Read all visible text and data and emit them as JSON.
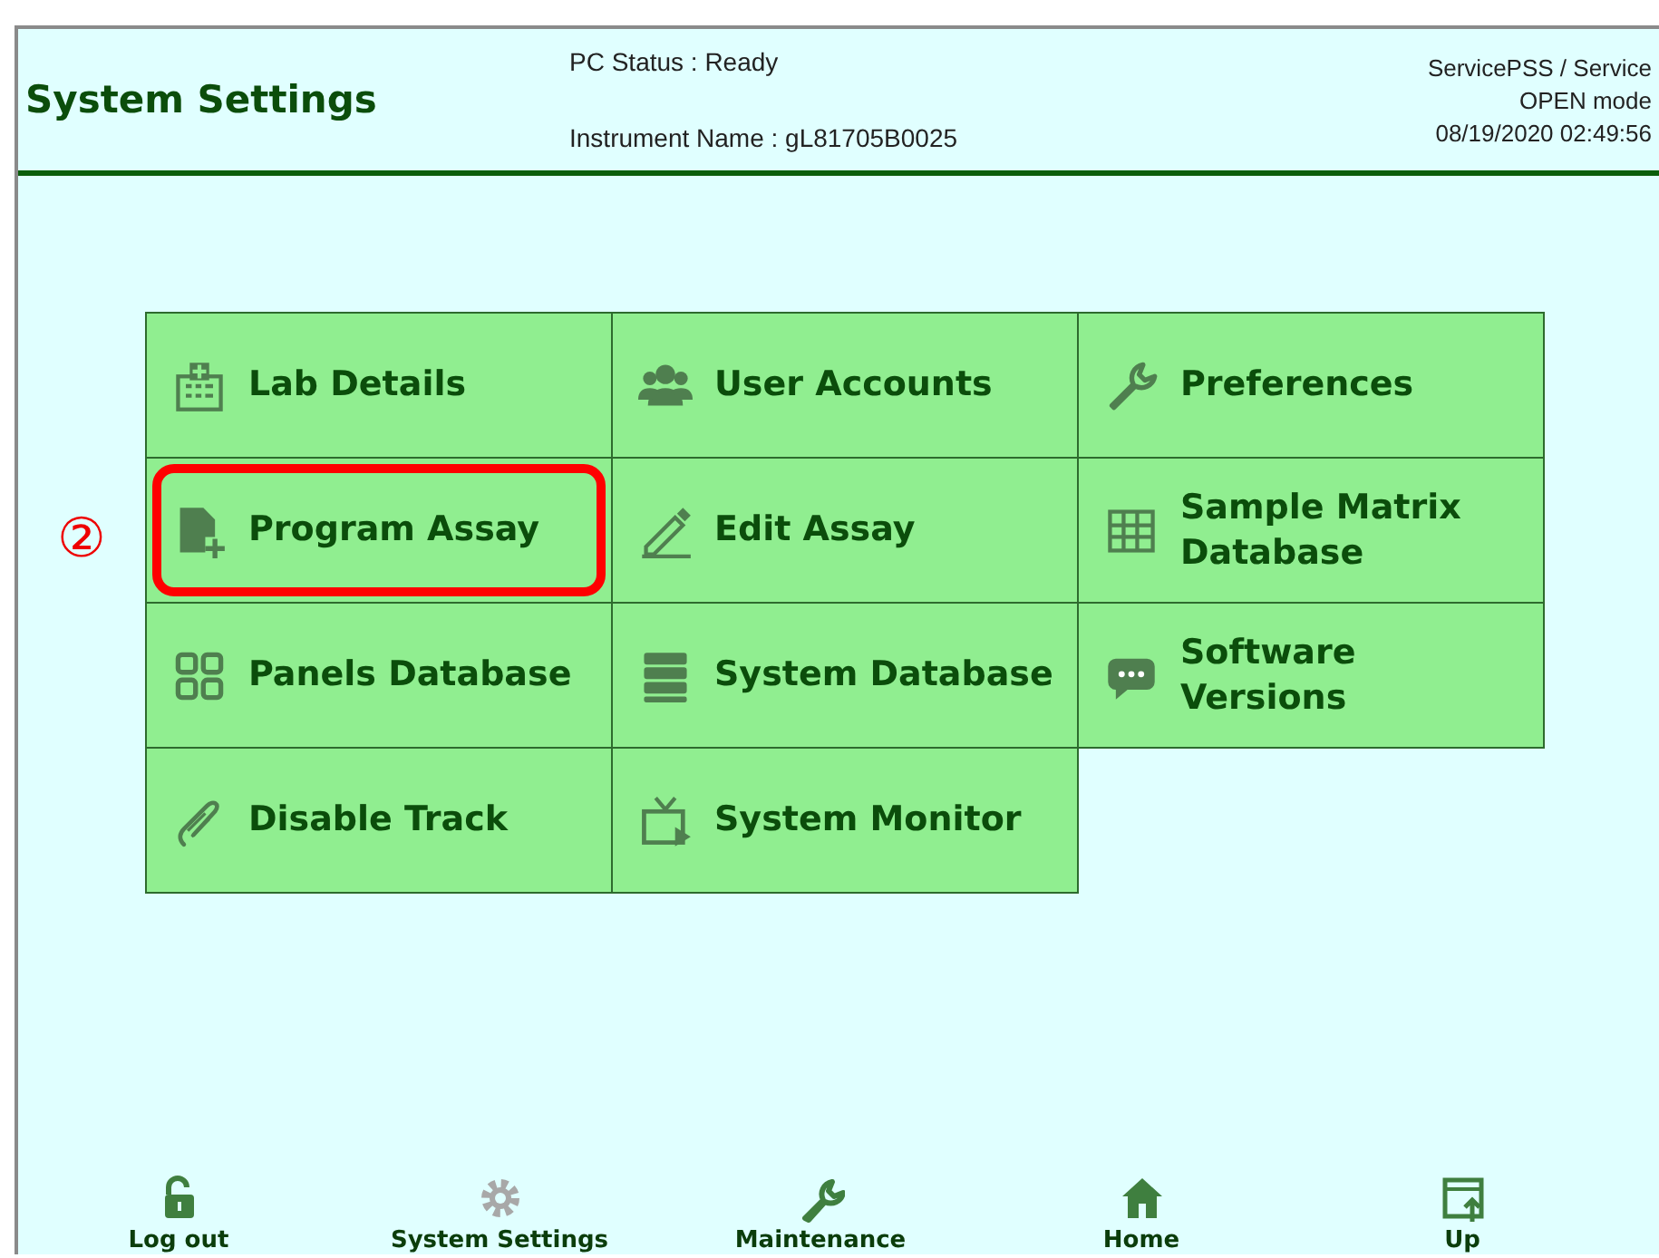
{
  "header": {
    "title": "System Settings",
    "pc_status": "PC Status : Ready",
    "instrument_name": "Instrument Name : gL81705B0025",
    "user": "ServicePSS / Service",
    "mode": "OPEN mode",
    "datetime": "08/19/2020 02:49:56"
  },
  "tiles": [
    {
      "label": "Lab Details",
      "highlighted": false
    },
    {
      "label": "User Accounts",
      "highlighted": false
    },
    {
      "label": "Preferences",
      "highlighted": false
    },
    {
      "label": "Program Assay",
      "highlighted": true
    },
    {
      "label": "Edit Assay",
      "highlighted": false
    },
    {
      "label": "Sample Matrix Database",
      "highlighted": false
    },
    {
      "label": "Panels Database",
      "highlighted": false
    },
    {
      "label": "System Database",
      "highlighted": false
    },
    {
      "label": "Software Versions",
      "highlighted": false
    },
    {
      "label": "Disable Track",
      "highlighted": false
    },
    {
      "label": "System Monitor",
      "highlighted": false
    }
  ],
  "callout": {
    "label": "②"
  },
  "nav": [
    {
      "label": "Log out",
      "disabled": false
    },
    {
      "label": "System Settings",
      "disabled": true
    },
    {
      "label": "Maintenance",
      "disabled": false
    },
    {
      "label": "Home",
      "disabled": false
    },
    {
      "label": "Up",
      "disabled": false
    }
  ]
}
